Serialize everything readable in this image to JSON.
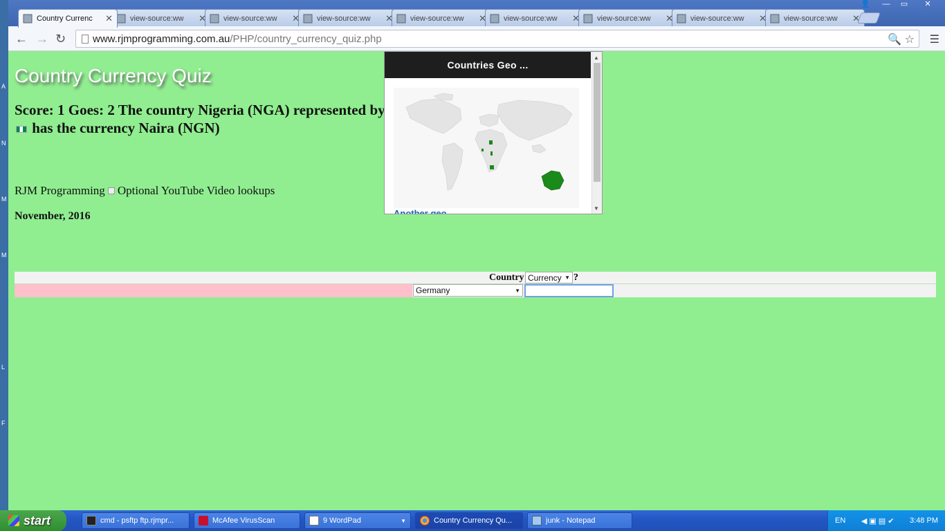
{
  "desktop": {
    "letters": [
      "A",
      "N",
      "M",
      "M",
      "L",
      "F"
    ]
  },
  "browser": {
    "tabs": [
      {
        "title": "Country Currenc",
        "active": true
      },
      {
        "title": "view-source:ww",
        "active": false
      },
      {
        "title": "view-source:ww",
        "active": false
      },
      {
        "title": "view-source:ww",
        "active": false
      },
      {
        "title": "view-source:ww",
        "active": false
      },
      {
        "title": "view-source:ww",
        "active": false
      },
      {
        "title": "view-source:ww",
        "active": false
      },
      {
        "title": "view-source:ww",
        "active": false
      },
      {
        "title": "view-source:ww",
        "active": false
      }
    ],
    "url_host": "www.rjmprogramming.com.au",
    "url_path": "/PHP/country_currency_quiz.php"
  },
  "page": {
    "title": "Country Currency Quiz",
    "score_text_before_flag": "Score: 1 Goes: 2 The country Nigeria (NGA) represented by",
    "score_text_after_flag": "has the currency Naira (NGN)",
    "rjm_label": "RJM Programming",
    "youtube_label": "Optional YouTube Video lookups",
    "date": "November, 2016",
    "widget": {
      "heading": "Countries Geo ...",
      "link_text": "Another geo"
    },
    "quiz": {
      "header_label": "Country",
      "mode_select_value": "Currency",
      "question_mark": "?",
      "country_select_value": "Germany",
      "answer_value": ""
    }
  },
  "taskbar": {
    "start_label": "start",
    "items": [
      {
        "label": "cmd - psftp ftp.rjmpr...",
        "icon_color": "#222222"
      },
      {
        "label": "McAfee VirusScan",
        "icon_color": "#c8102e"
      },
      {
        "label": "9 WordPad",
        "icon_color": "#ffffff"
      },
      {
        "label": "Country Currency Qu...",
        "icon_color": "#e8b02a"
      },
      {
        "label": "junk - Notepad",
        "icon_color": "#9ecbf0"
      }
    ],
    "tray": {
      "lang": "EN",
      "time": "3:48 PM"
    }
  }
}
